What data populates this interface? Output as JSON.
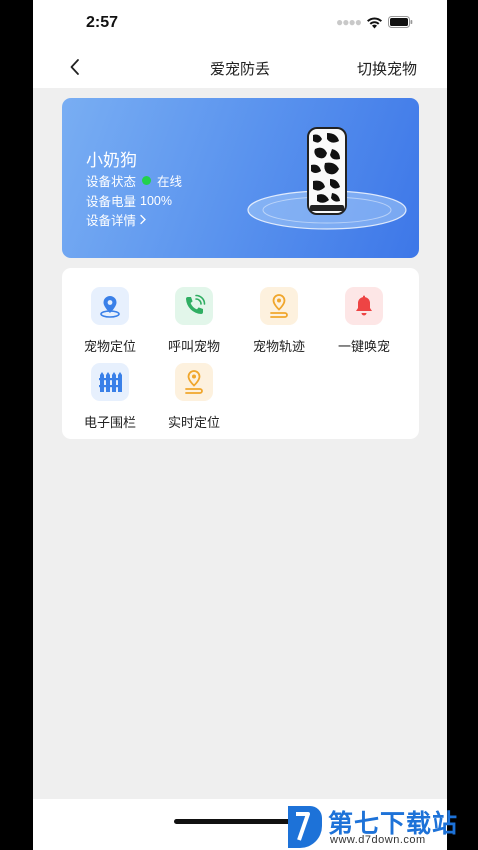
{
  "status_bar": {
    "time": "2:57"
  },
  "nav": {
    "title": "爱宠防丢",
    "right_action": "切换宠物",
    "back_icon": "chevron-left-icon"
  },
  "pet_card": {
    "name": "小奶狗",
    "status_label": "设备状态",
    "status_value": "在线",
    "battery_label": "设备电量",
    "battery_value": "100%",
    "battery_level": 1.0,
    "detail_link": "设备详情",
    "status_color": "#22d14b",
    "gradient_start": "#79aef3",
    "gradient_end": "#3d77e8"
  },
  "features": [
    {
      "label": "宠物定位",
      "icon": "location-pin-icon",
      "bg": "#e7f0fd",
      "color": "#3a80e8"
    },
    {
      "label": "呼叫宠物",
      "icon": "phone-icon",
      "bg": "#e2f6ea",
      "color": "#2fae62"
    },
    {
      "label": "宠物轨迹",
      "icon": "track-pin-icon",
      "bg": "#fdf1de",
      "color": "#f0a62c"
    },
    {
      "label": "一键唤宠",
      "icon": "bell-icon",
      "bg": "#fde6e6",
      "color": "#ee4444"
    },
    {
      "label": "电子围栏",
      "icon": "fence-icon",
      "bg": "#e7f0fd",
      "color": "#3a80e8"
    },
    {
      "label": "实时定位",
      "icon": "realtime-pin-icon",
      "bg": "#fdf1de",
      "color": "#f0a62c"
    }
  ],
  "watermark": {
    "title": "第七下载站",
    "url": "www.d7down.com"
  }
}
